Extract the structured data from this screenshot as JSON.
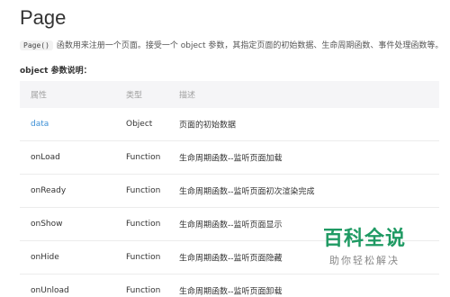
{
  "page": {
    "title": "Page",
    "intro_code": "Page()",
    "intro_text": "函数用来注册一个页面。接受一个 object 参数，其指定页面的初始数据、生命周期函数、事件处理函数等。",
    "section_label": "object 参数说明："
  },
  "table": {
    "headers": [
      "属性",
      "类型",
      "描述"
    ],
    "rows": [
      {
        "name": "data",
        "type": "Object",
        "desc": "页面的初始数据"
      },
      {
        "name": "onLoad",
        "type": "Function",
        "desc": "生命周期函数--监听页面加载"
      },
      {
        "name": "onReady",
        "type": "Function",
        "desc": "生命周期函数--监听页面初次渲染完成"
      },
      {
        "name": "onShow",
        "type": "Function",
        "desc": "生命周期函数--监听页面显示"
      },
      {
        "name": "onHide",
        "type": "Function",
        "desc": "生命周期函数--监听页面隐藏"
      },
      {
        "name": "onUnload",
        "type": "Function",
        "desc": "生命周期函数--监听页面卸载"
      }
    ]
  },
  "watermark": {
    "main": "百科全说",
    "sub": "助你轻松解决"
  },
  "colors": {
    "link": "#3b8fd6",
    "header_bg": "#f5f5f7",
    "watermark_green": "#1f9a63"
  }
}
